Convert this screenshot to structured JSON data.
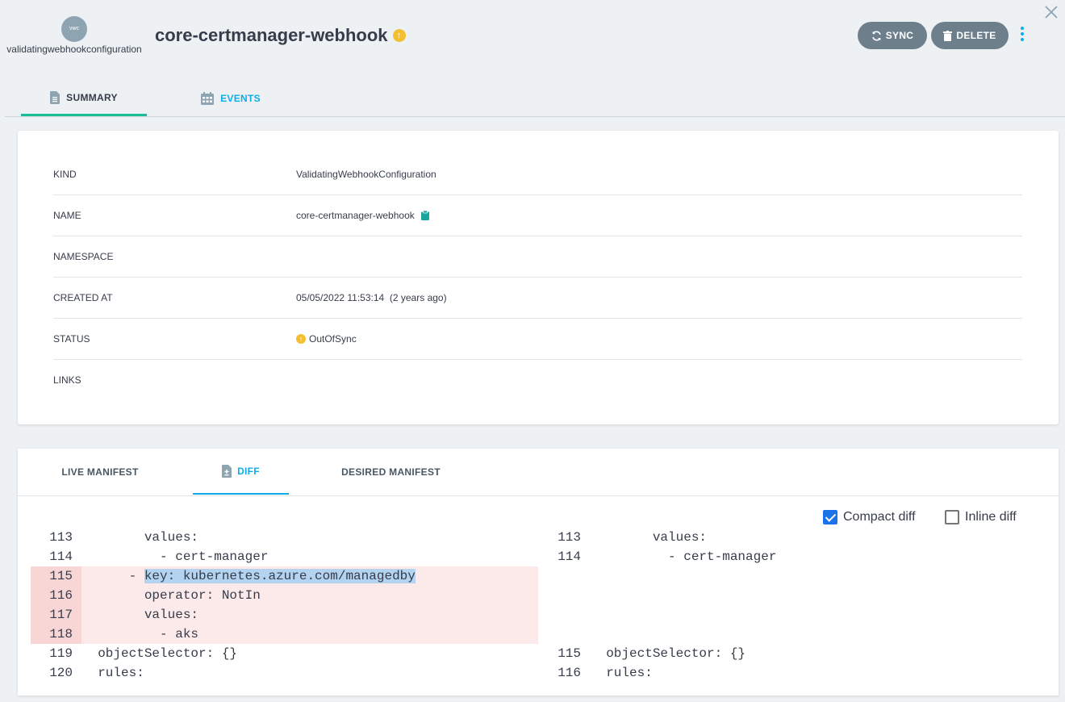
{
  "header": {
    "kind_abbrev": "vwc",
    "kind_label": "validatingwebhookconfiguration",
    "title": "core-certmanager-webhook",
    "status_symbol": "↑",
    "sync_label": "SYNC",
    "delete_label": "DELETE"
  },
  "tabs": [
    {
      "label": "SUMMARY",
      "active": true
    },
    {
      "label": "EVENTS",
      "active": false
    }
  ],
  "summary": {
    "rows": [
      {
        "label": "KIND",
        "value": "ValidatingWebhookConfiguration"
      },
      {
        "label": "NAME",
        "value": "core-certmanager-webhook"
      },
      {
        "label": "NAMESPACE",
        "value": ""
      },
      {
        "label": "CREATED AT",
        "value": "05/05/2022 11:53:14  (2 years ago)"
      },
      {
        "label": "STATUS",
        "value": "OutOfSync"
      },
      {
        "label": "LINKS",
        "value": ""
      }
    ]
  },
  "manifest_tabs": [
    {
      "label": "LIVE MANIFEST"
    },
    {
      "label": "DIFF",
      "active": true
    },
    {
      "label": "DESIRED MANIFEST"
    }
  ],
  "diff_options": {
    "compact_label": "Compact diff",
    "compact_checked": true,
    "inline_label": "Inline diff",
    "inline_checked": false
  },
  "diff": {
    "left": [
      {
        "num": "113",
        "text": "        values:",
        "removed": false
      },
      {
        "num": "114",
        "text": "          - cert-manager",
        "removed": false
      },
      {
        "num": "115",
        "text": "      - key: kubernetes.azure.com/managedby",
        "removed": true
      },
      {
        "num": "116",
        "text": "        operator: NotIn",
        "removed": true
      },
      {
        "num": "117",
        "text": "        values:",
        "removed": true
      },
      {
        "num": "118",
        "text": "          - aks",
        "removed": true
      },
      {
        "num": "119",
        "text": "  objectSelector: {}",
        "removed": false
      },
      {
        "num": "120",
        "text": "  rules:",
        "removed": false
      }
    ],
    "right": [
      {
        "num": "113",
        "text": "        values:"
      },
      {
        "num": "114",
        "text": "          - cert-manager"
      },
      {
        "num": "",
        "text": ""
      },
      {
        "num": "",
        "text": ""
      },
      {
        "num": "",
        "text": ""
      },
      {
        "num": "",
        "text": ""
      },
      {
        "num": "115",
        "text": "  objectSelector: {}"
      },
      {
        "num": "116",
        "text": "  rules:"
      }
    ]
  },
  "colors": {
    "accent": "#0dadea",
    "active_tab_underline": "#18be94",
    "out_of_sync": "#f4c030",
    "button_bg": "#6d7f8b",
    "removed_bg": "#fce9e9"
  }
}
